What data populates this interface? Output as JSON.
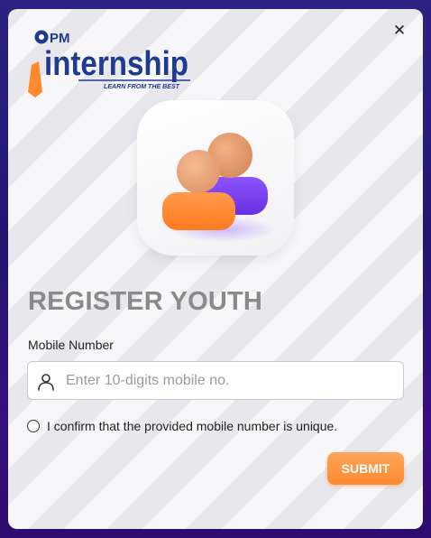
{
  "modal": {
    "logo": {
      "prefix": "PM",
      "wordmark": "internship",
      "tagline": "LEARN FROM THE BEST"
    },
    "close_label": "✕",
    "title": "REGISTER YOUTH",
    "mobile_field": {
      "label": "Mobile Number",
      "value": "",
      "placeholder": "Enter 10-digits mobile no."
    },
    "confirm_text": "I confirm that the provided mobile number is unique.",
    "submit_label": "SUBMIT"
  },
  "colors": {
    "accent_orange": "#ff8a2e",
    "logo_blue": "#1f3b8f",
    "avatar_purple": "#7a3cf0",
    "title_gray": "#8a8a8a",
    "backdrop_purple": "#3b2fa8"
  },
  "icons": [
    "close-icon",
    "user-icon",
    "users-icon"
  ]
}
